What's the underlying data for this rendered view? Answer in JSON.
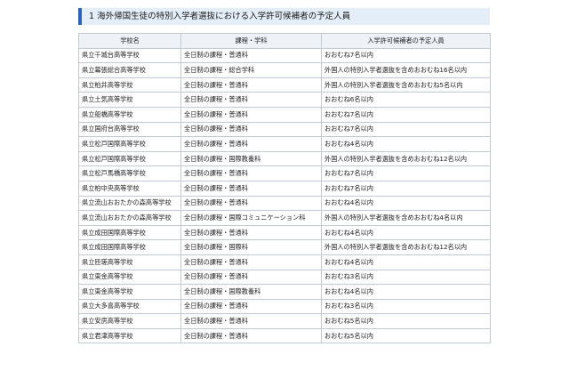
{
  "heading": "1 海外帰国生徒の特別入学者選抜における入学許可候補者の予定人員",
  "columns": [
    "学校名",
    "課程・学科",
    "入学許可候補者の予定人員"
  ],
  "rows": [
    [
      "県立千城台高等学校",
      "全日制の課程・普通科",
      "おおむね7名以内"
    ],
    [
      "県立幕張総合高等学校",
      "全日制の課程・総合学科",
      "外国人の特別入学者選抜を含めおおむね16名以内"
    ],
    [
      "県立柏井高等学校",
      "全日制の課程・普通科",
      "外国人の特別入学者選抜を含めおおむね5名以内"
    ],
    [
      "県立土気高等学校",
      "全日制の課程・普通科",
      "おおむね6名以内"
    ],
    [
      "県立船橋高等学校",
      "全日制の課程・普通科",
      "おおむね7名以内"
    ],
    [
      "県立国府台高等学校",
      "全日制の課程・普通科",
      "おおむね7名以内"
    ],
    [
      "県立松戸国際高等学校",
      "全日制の課程・普通科",
      "おおむね4名以内"
    ],
    [
      "県立松戸国際高等学校",
      "全日制の課程・国際教養科",
      "外国人の特別入学者選抜を含めおおむね12名以内"
    ],
    [
      "県立松戸馬橋高等学校",
      "全日制の課程・普通科",
      "おおむね7名以内"
    ],
    [
      "県立柏中央高等学校",
      "全日制の課程・普通科",
      "おおむね7名以内"
    ],
    [
      "県立流山おおたかの森高等学校",
      "全日制の課程・普通科",
      "おおむね4名以内"
    ],
    [
      "県立流山おおたかの森高等学校",
      "全日制の課程・国際コミュニケーション科",
      "外国人の特別入学者選抜を含めおおむね4名以内"
    ],
    [
      "県立成田国際高等学校",
      "全日制の課程・普通科",
      "おおむね4名以内"
    ],
    [
      "県立成田国際高等学校",
      "全日制の課程・国際科",
      "外国人の特別入学者選抜を含めおおむね12名以内"
    ],
    [
      "県立匝瑳高等学校",
      "全日制の課程・普通科",
      "おおむね4名以内"
    ],
    [
      "県立東金高等学校",
      "全日制の課程・普通科",
      "おおむね3名以内"
    ],
    [
      "県立東金高等学校",
      "全日制の課程・国際教養科",
      "おおむね4名以内"
    ],
    [
      "県立大多喜高等学校",
      "全日制の課程・普通科",
      "おおむね3名以内"
    ],
    [
      "県立安房高等学校",
      "全日制の課程・普通科",
      "おおむね5名以内"
    ],
    [
      "県立君津高等学校",
      "全日制の課程・普通科",
      "おおむね5名以内"
    ]
  ]
}
